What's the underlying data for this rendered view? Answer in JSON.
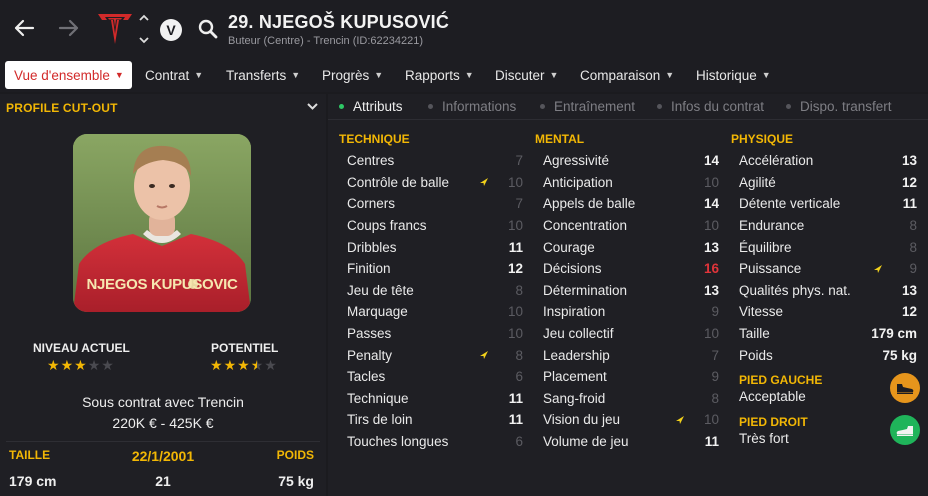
{
  "header": {
    "player_name": "29. NJEGOŠ KUPUSOVIĆ",
    "player_subtitle": "Buteur (Centre) - Trencin (ID:62234221)",
    "club_badge_letter": "V"
  },
  "nav": {
    "items": [
      {
        "label": "Vue d'ensemble",
        "active": true
      },
      {
        "label": "Contrat"
      },
      {
        "label": "Transferts"
      },
      {
        "label": "Progrès"
      },
      {
        "label": "Rapports"
      },
      {
        "label": "Discuter"
      },
      {
        "label": "Comparaison"
      },
      {
        "label": "Historique"
      }
    ]
  },
  "profile": {
    "title": "PROFILE CUT-OUT",
    "shirt_text": "NJEGOS KUPUSOVIC",
    "current_label": "NIVEAU ACTUEL",
    "potential_label": "POTENTIEL",
    "current_stars": 3,
    "potential_stars": 3.5,
    "contract": "Sous contrat avec Trencin",
    "value": "220K € - 425K €",
    "height_label": "TAILLE",
    "dob": "22/1/2001",
    "weight_label": "POIDS",
    "height": "179 cm",
    "age": "21",
    "weight": "75 kg"
  },
  "subtabs": [
    {
      "label": "Attributs",
      "active": true
    },
    {
      "label": "Informations"
    },
    {
      "label": "Entraînement"
    },
    {
      "label": "Infos du contrat"
    },
    {
      "label": "Dispo. transfert"
    }
  ],
  "attributes": {
    "technique": {
      "title": "TECHNIQUE",
      "rows": [
        {
          "name": "Centres",
          "value": "7"
        },
        {
          "name": "Contrôle de balle",
          "value": "10",
          "arrow": true
        },
        {
          "name": "Corners",
          "value": "7"
        },
        {
          "name": "Coups francs",
          "value": "10"
        },
        {
          "name": "Dribbles",
          "value": "11"
        },
        {
          "name": "Finition",
          "value": "12"
        },
        {
          "name": "Jeu de tête",
          "value": "8"
        },
        {
          "name": "Marquage",
          "value": "10"
        },
        {
          "name": "Passes",
          "value": "10"
        },
        {
          "name": "Penalty",
          "value": "8",
          "arrow": true
        },
        {
          "name": "Tacles",
          "value": "6"
        },
        {
          "name": "Technique",
          "value": "11"
        },
        {
          "name": "Tirs de loin",
          "value": "11"
        },
        {
          "name": "Touches longues",
          "value": "6"
        }
      ]
    },
    "mental": {
      "title": "MENTAL",
      "rows": [
        {
          "name": "Agressivité",
          "value": "14"
        },
        {
          "name": "Anticipation",
          "value": "10"
        },
        {
          "name": "Appels de balle",
          "value": "14"
        },
        {
          "name": "Concentration",
          "value": "10"
        },
        {
          "name": "Courage",
          "value": "13"
        },
        {
          "name": "Décisions",
          "value": "16",
          "color": "red"
        },
        {
          "name": "Détermination",
          "value": "13"
        },
        {
          "name": "Inspiration",
          "value": "9"
        },
        {
          "name": "Jeu collectif",
          "value": "10"
        },
        {
          "name": "Leadership",
          "value": "7"
        },
        {
          "name": "Placement",
          "value": "9"
        },
        {
          "name": "Sang-froid",
          "value": "8"
        },
        {
          "name": "Vision du jeu",
          "value": "10",
          "arrow": true
        },
        {
          "name": "Volume de jeu",
          "value": "11"
        }
      ]
    },
    "physique": {
      "title": "PHYSIQUE",
      "rows": [
        {
          "name": "Accélération",
          "value": "13"
        },
        {
          "name": "Agilité",
          "value": "12"
        },
        {
          "name": "Détente verticale",
          "value": "11"
        },
        {
          "name": "Endurance",
          "value": "8"
        },
        {
          "name": "Équilibre",
          "value": "8"
        },
        {
          "name": "Puissance",
          "value": "9",
          "arrow": true
        },
        {
          "name": "Qualités phys. nat.",
          "value": "13"
        },
        {
          "name": "Vitesse",
          "value": "12"
        },
        {
          "name": "Taille",
          "value": "179 cm",
          "plain": true
        },
        {
          "name": "Poids",
          "value": "75 kg",
          "plain": true
        }
      ],
      "left_foot_label": "PIED GAUCHE",
      "left_foot_value": "Acceptable",
      "right_foot_label": "PIED DROIT",
      "right_foot_value": "Très fort"
    }
  },
  "colors": {
    "accent_yellow": "#f2b705",
    "active_red": "#d22a2a",
    "tab_dot_green": "#2ec866",
    "foot_left_orange": "#e6951c",
    "foot_right_green": "#1fb45a"
  }
}
